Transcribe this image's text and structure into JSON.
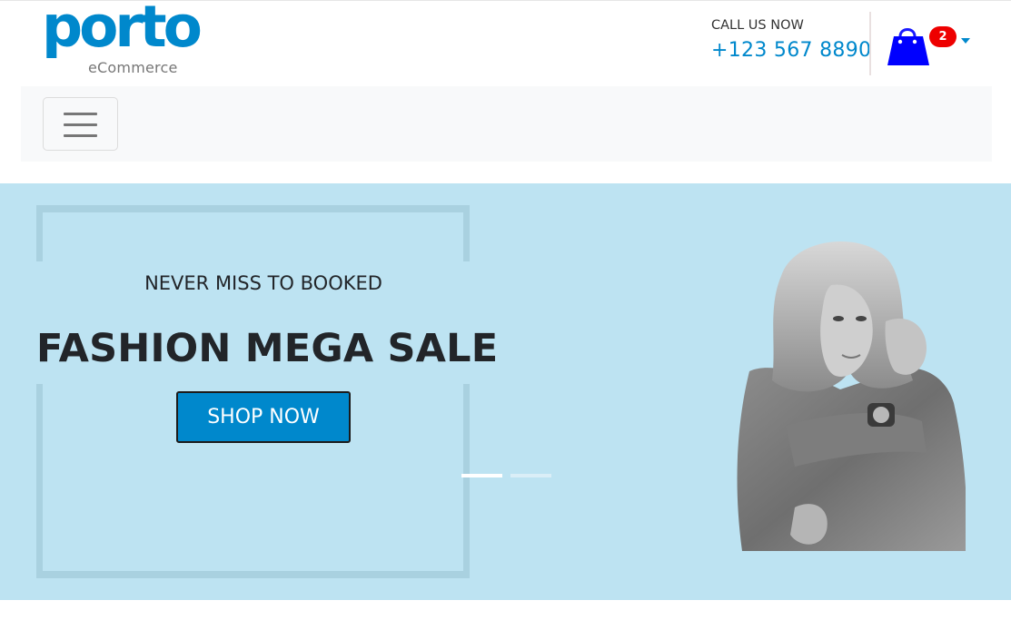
{
  "header": {
    "logo": {
      "word": "porto",
      "sub": "eCommerce"
    },
    "call_label": "CALL US NOW",
    "phone": "+123 567 8890",
    "cart": {
      "icon": "shopping-bag-icon",
      "count": "2",
      "caret_icon": "caret-down-icon"
    }
  },
  "navbar": {
    "toggle_icon": "hamburger-menu-icon"
  },
  "hero": {
    "subtitle": "NEVER MISS TO BOOKED",
    "title": "FASHION MEGA SALE",
    "button_label": "SHOP NOW",
    "slides": {
      "count": 2,
      "active": 1
    }
  },
  "colors": {
    "brand": "#0088cc",
    "badge": "#ee0000",
    "hero_bg": "#bde3f2",
    "frame": "#a9d1e0",
    "navbar_bg": "#f8f9fa",
    "text_dark": "#222529"
  }
}
